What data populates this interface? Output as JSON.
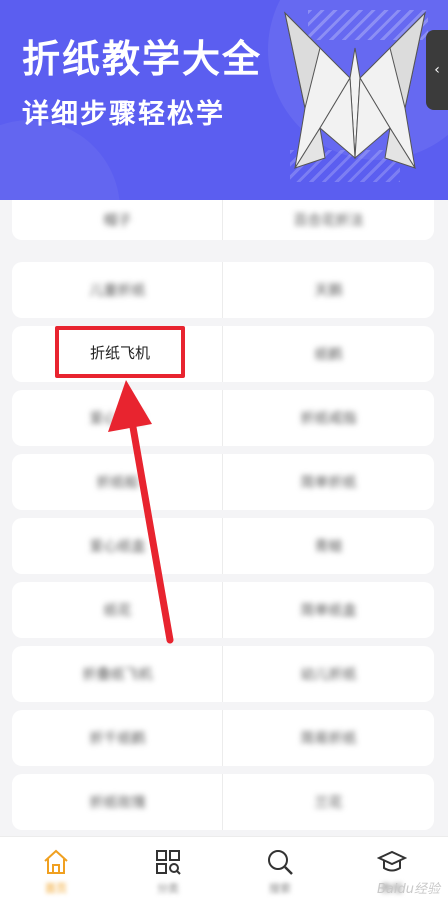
{
  "banner": {
    "title": "折纸教学大全",
    "subtitle": "详细步骤轻松学",
    "side_tab_icon": "chevron-left-icon"
  },
  "carousel": {
    "pages": 4,
    "active_index": 3
  },
  "categories": [
    {
      "left": "帽子",
      "right": "百合花折法"
    },
    {
      "left": "儿童折纸",
      "right": "天鹅"
    },
    {
      "left": "折纸飞机",
      "right": "纸鹤"
    },
    {
      "left": "爱心折法",
      "right": "折纸戒指"
    },
    {
      "left": "折纸船",
      "right": "简单折纸"
    },
    {
      "left": "爱心纸盒",
      "right": "青蛙"
    },
    {
      "left": "纸花",
      "right": "简单纸盒"
    },
    {
      "left": "折叠纸飞机",
      "right": "幼儿折纸"
    },
    {
      "left": "折千纸鹤",
      "right": "简易折纸"
    },
    {
      "left": "折纸玫瑰",
      "right": "兰花"
    }
  ],
  "highlighted_item": "折纸飞机",
  "tabbar": {
    "items": [
      {
        "label": "首页",
        "icon": "home-icon",
        "active": true
      },
      {
        "label": "分类",
        "icon": "grid-icon",
        "active": false
      },
      {
        "label": "搜索",
        "icon": "search-icon",
        "active": false
      },
      {
        "label": "教程",
        "icon": "graduation-cap-icon",
        "active": false
      }
    ]
  },
  "watermark": "Baidu经验",
  "colors": {
    "banner": "#5b5ef0",
    "accent": "#f5c02a",
    "highlight": "#e8242f",
    "active_tab": "#f0a020"
  }
}
